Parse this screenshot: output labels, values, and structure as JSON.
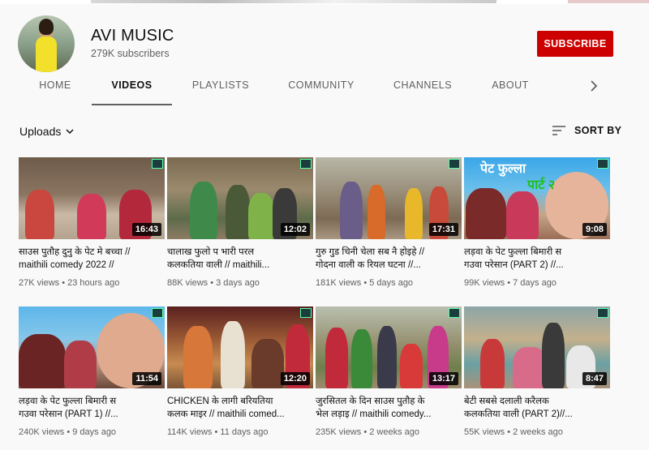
{
  "channel": {
    "name": "AVI MUSIC",
    "subscribers": "279K subscribers",
    "subscribe_label": "SUBSCRIBE"
  },
  "tabs": [
    {
      "label": "HOME",
      "active": false
    },
    {
      "label": "VIDEOS",
      "active": true
    },
    {
      "label": "PLAYLISTS",
      "active": false
    },
    {
      "label": "COMMUNITY",
      "active": false
    },
    {
      "label": "CHANNELS",
      "active": false
    },
    {
      "label": "ABOUT",
      "active": false
    }
  ],
  "toolbar": {
    "uploads_label": "Uploads",
    "sort_label": "SORT BY"
  },
  "videos": [
    {
      "title_line1": "साउस पुतौह दुनु के पेट मे बच्चा //",
      "title_line2": "maithili comedy 2022 //",
      "views": "27K views",
      "age": "23 hours ago",
      "duration": "16:43"
    },
    {
      "title_line1": "चालाख फुलो प भारी परल",
      "title_line2": "कलकतिया वाली // maithili...",
      "views": "88K views",
      "age": "3 days ago",
      "duration": "12:02"
    },
    {
      "title_line1": "गुरु गुड चिनी चेला सब नै होइहे //",
      "title_line2": "गोदना वाली क रियल घटना //...",
      "views": "181K views",
      "age": "5 days ago",
      "duration": "17:31"
    },
    {
      "title_line1": "लड़वा के पेट फुल्ला बिमारी स",
      "title_line2": "गउवा परेसान (PART 2) //...",
      "views": "99K views",
      "age": "7 days ago",
      "duration": "9:08",
      "overlay_text": "पेट फुल्ला",
      "overlay_text2": "पार्ट २"
    },
    {
      "title_line1": "लड़वा के पेट फुल्ला बिमारी स",
      "title_line2": "गउवा परेसान (PART 1) //...",
      "views": "240K views",
      "age": "9 days ago",
      "duration": "11:54"
    },
    {
      "title_line1": "CHICKEN के लागी बरियतिया",
      "title_line2": "कलक माइर // maithili comed...",
      "views": "114K views",
      "age": "11 days ago",
      "duration": "12:20"
    },
    {
      "title_line1": "जुरसितल के दिन साउस पुतौह के",
      "title_line2": "भेल लड़ाइ // maithili comedy...",
      "views": "235K views",
      "age": "2 weeks ago",
      "duration": "13:17"
    },
    {
      "title_line1": "बेटी सबसे दलाली करैलक",
      "title_line2": "कलकतिया वाली (PART 2)//...",
      "views": "55K views",
      "age": "2 weeks ago",
      "duration": "8:47"
    }
  ],
  "colors": {
    "subscribe_bg": "#cc0000",
    "background": "#f9f9f9",
    "text_secondary": "#606060"
  }
}
